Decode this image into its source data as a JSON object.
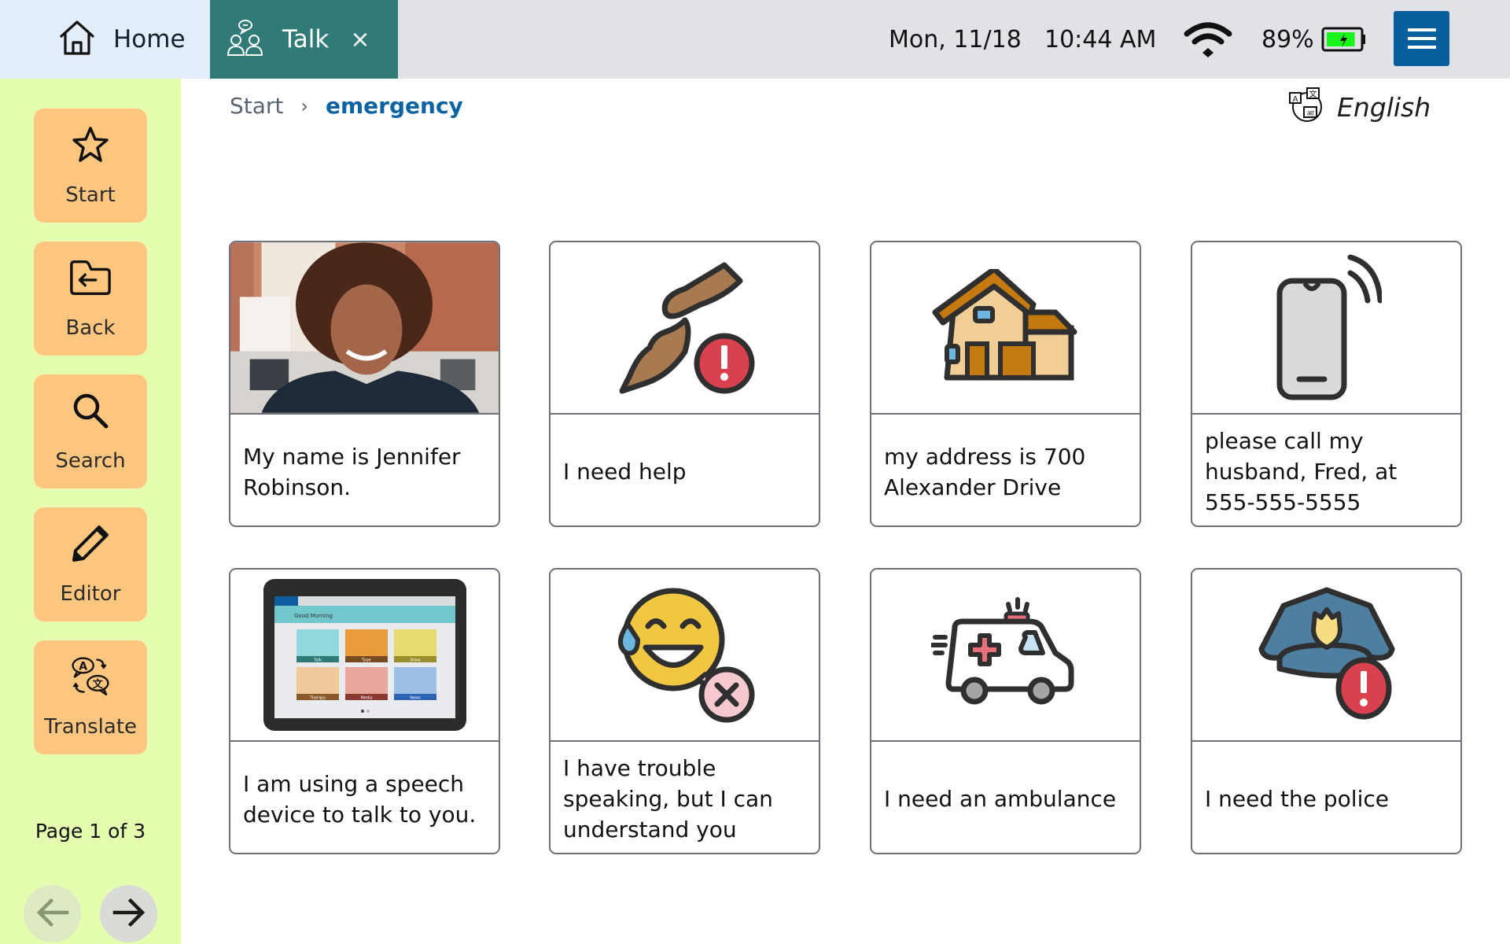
{
  "topbar": {
    "home_tab": {
      "label": "Home",
      "icon": "home-icon"
    },
    "talk_tab": {
      "label": "Talk",
      "icon": "talk-people-icon",
      "close_label": "×"
    },
    "date": "Mon,  11/18",
    "time": "10:44 AM",
    "wifi_icon": "wifi-icon",
    "battery_percent": "89%",
    "battery_level": 0.89,
    "battery_charging": true,
    "menu_icon": "hamburger-menu-icon"
  },
  "colors": {
    "home_tab_bg": "#E3EEFA",
    "talk_tab_bg": "#307A78",
    "topbar_bg": "#E1E2E6",
    "sidebar_bg": "#E5FDAF",
    "sidebar_button_bg": "#FFC67F",
    "menu_button_bg": "#075E9D",
    "breadcrumb_current": "#0C63A3",
    "battery_fill": "#19F51B"
  },
  "sidebar": {
    "items": [
      {
        "label": "Start",
        "icon": "star-icon"
      },
      {
        "label": "Back",
        "icon": "folder-back-icon"
      },
      {
        "label": "Search",
        "icon": "search-icon"
      },
      {
        "label": "Editor",
        "icon": "pencil-icon"
      },
      {
        "label": "Translate",
        "icon": "translate-icon"
      }
    ],
    "page_indicator": "Page 1 of 3",
    "prev_icon": "arrow-left-icon",
    "next_icon": "arrow-right-icon"
  },
  "breadcrumb": {
    "items": [
      "Start",
      "emergency"
    ],
    "separator": "›"
  },
  "language": {
    "label": "English",
    "icon": "languages-globe-icon"
  },
  "cards": [
    {
      "text": "My name is Jennifer Robinson.",
      "image": "woman-portrait-photo"
    },
    {
      "text": "I need help",
      "image": "helping-hands-alert-icon"
    },
    {
      "text": "my address is 700 Alexander Drive",
      "image": "house-icon"
    },
    {
      "text": "please call my husband, Fred, at 555-555-5555",
      "image": "ringing-phone-icon"
    },
    {
      "text": "I am using a speech device to talk to you.",
      "image": "speech-device-tablet-photo"
    },
    {
      "text": "I have trouble speaking, but I can understand you",
      "image": "sweat-smile-no-speech-icon"
    },
    {
      "text": "I need an ambulance",
      "image": "ambulance-icon"
    },
    {
      "text": "I need the police",
      "image": "police-cap-alert-icon"
    }
  ],
  "tablet_screen": {
    "greeting": "Good Morning",
    "tiles": [
      "Talk",
      "Type",
      "Draw",
      "Therapy",
      "Media",
      "News"
    ]
  }
}
